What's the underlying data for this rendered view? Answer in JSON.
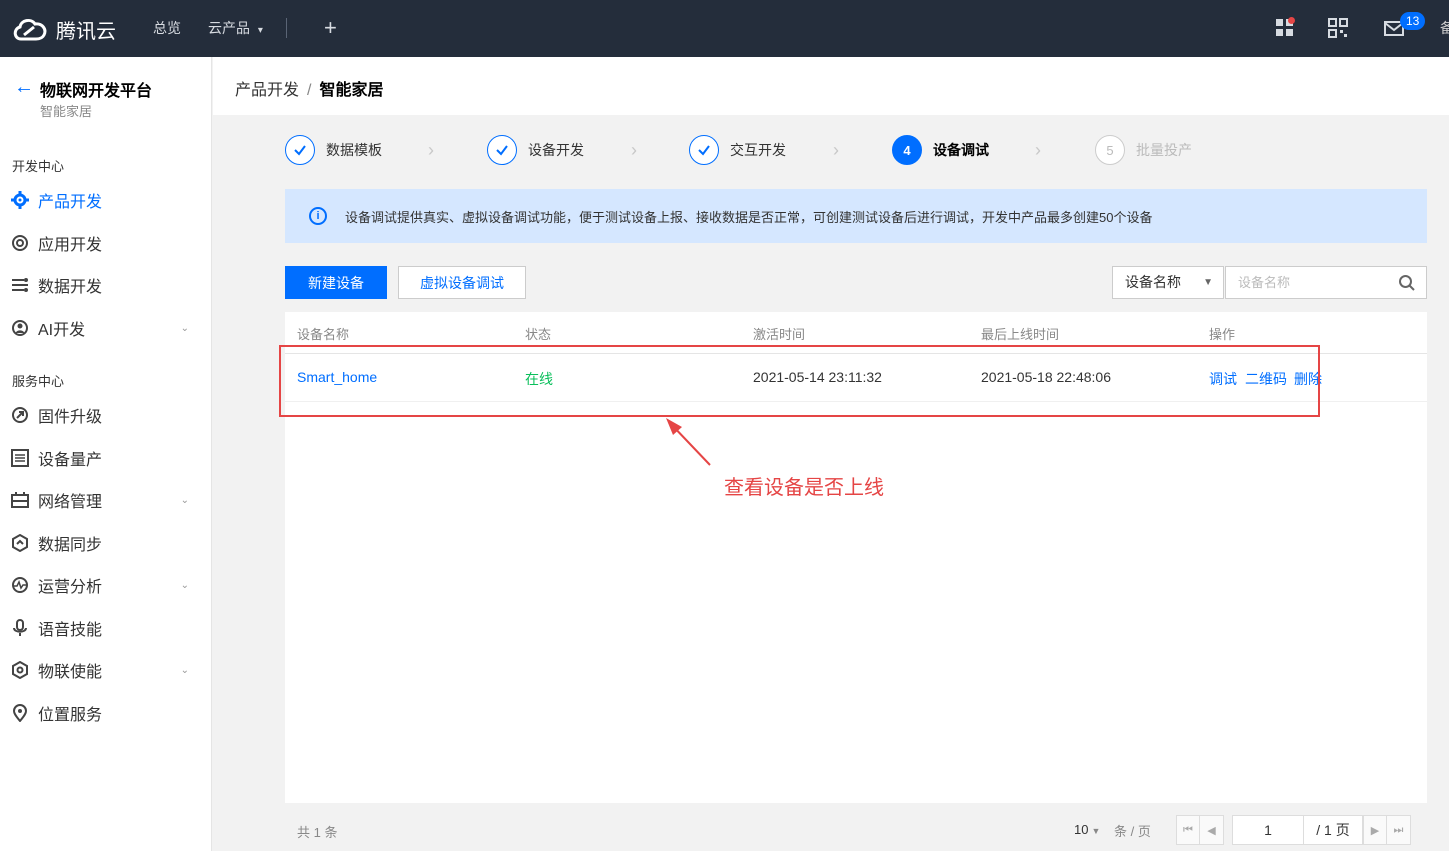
{
  "topbar": {
    "brand": "腾讯云",
    "nav_overview": "总览",
    "nav_products": "云产品",
    "nav_products_caret": "▾",
    "plus": "+",
    "mail_badge": "13",
    "edge_char": "备"
  },
  "sidebar": {
    "back_icon": "←",
    "title": "物联网开发平台",
    "subtitle": "智能家居",
    "sec_dev": "开发中心",
    "sec_service": "服务中心",
    "items": [
      {
        "label": "产品开发",
        "icon": "gear-icon"
      },
      {
        "label": "应用开发",
        "icon": "app-icon"
      },
      {
        "label": "数据开发",
        "icon": "data-flow-icon"
      },
      {
        "label": "AI开发",
        "icon": "ai-icon"
      },
      {
        "label": "固件升级",
        "icon": "firmware-icon"
      },
      {
        "label": "设备量产",
        "icon": "list-icon"
      },
      {
        "label": "网络管理",
        "icon": "network-icon"
      },
      {
        "label": "数据同步",
        "icon": "sync-icon"
      },
      {
        "label": "运营分析",
        "icon": "analysis-icon"
      },
      {
        "label": "语音技能",
        "icon": "voice-icon"
      },
      {
        "label": "物联使能",
        "icon": "enable-icon"
      },
      {
        "label": "位置服务",
        "icon": "location-icon"
      }
    ]
  },
  "breadcrumb": {
    "parent": "产品开发",
    "sep": "/",
    "current": "智能家居"
  },
  "steps": [
    {
      "label": "数据模板",
      "state": "done",
      "num": "1"
    },
    {
      "label": "设备开发",
      "state": "done",
      "num": "2"
    },
    {
      "label": "交互开发",
      "state": "done",
      "num": "3"
    },
    {
      "label": "设备调试",
      "state": "current",
      "num": "4"
    },
    {
      "label": "批量投产",
      "state": "pending",
      "num": "5"
    }
  ],
  "banner": {
    "icon": "i",
    "text": "设备调试提供真实、虚拟设备调试功能，便于测试设备上报、接收数据是否正常，可创建测试设备后进行调试，开发中产品最多创建50个设备"
  },
  "toolbar": {
    "new_device": "新建设备",
    "virtual_debug": "虚拟设备调试",
    "filter_select": "设备名称",
    "search_placeholder": "设备名称"
  },
  "table": {
    "headers": [
      "设备名称",
      "状态",
      "激活时间",
      "最后上线时间",
      "操作"
    ],
    "rows": [
      {
        "name": "Smart_home",
        "status": "在线",
        "activated": "2021-05-14 23:11:32",
        "last_online": "2021-05-18 22:48:06",
        "actions": [
          "调试",
          "二维码",
          "删除"
        ]
      }
    ]
  },
  "annotation": {
    "text": "查看设备是否上线",
    "color": "#e54545"
  },
  "pagination": {
    "total_text": "共 1 条",
    "page_size": "10",
    "page_size_unit": "条 / 页",
    "current_page": "1",
    "total_pages": "/ 1 页",
    "first": "⏮",
    "prev": "◀",
    "next": "▶",
    "last": "⏭"
  },
  "colors": {
    "accent": "#006eff",
    "topbar": "#242d3b",
    "online": "#0abf5b",
    "annotation": "#e54545"
  }
}
